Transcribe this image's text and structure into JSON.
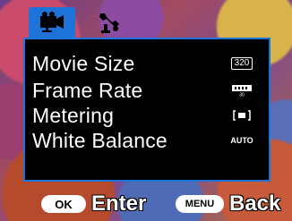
{
  "tabs": [
    {
      "name": "video",
      "icon": "video-camera-icon",
      "active": true
    },
    {
      "name": "setup",
      "icon": "wrench-icon",
      "active": false
    }
  ],
  "menu": {
    "items": [
      {
        "label": "Movie Size",
        "value_text": "320",
        "value_icon": "resolution-320-icon"
      },
      {
        "label": "Frame Rate",
        "value_text": "30",
        "value_icon": "frame-rate-30-icon"
      },
      {
        "label": "Metering",
        "value_text": "",
        "value_icon": "center-metering-icon"
      },
      {
        "label": "White Balance",
        "value_text": "AUTO",
        "value_icon": "auto-white-balance-icon"
      }
    ]
  },
  "footer": {
    "ok_key": "OK",
    "ok_action": "Enter",
    "menu_key": "MENU",
    "menu_action": "Back"
  },
  "colors": {
    "accent": "#1e73d8",
    "panel": "#000000",
    "text": "#ffffff"
  }
}
